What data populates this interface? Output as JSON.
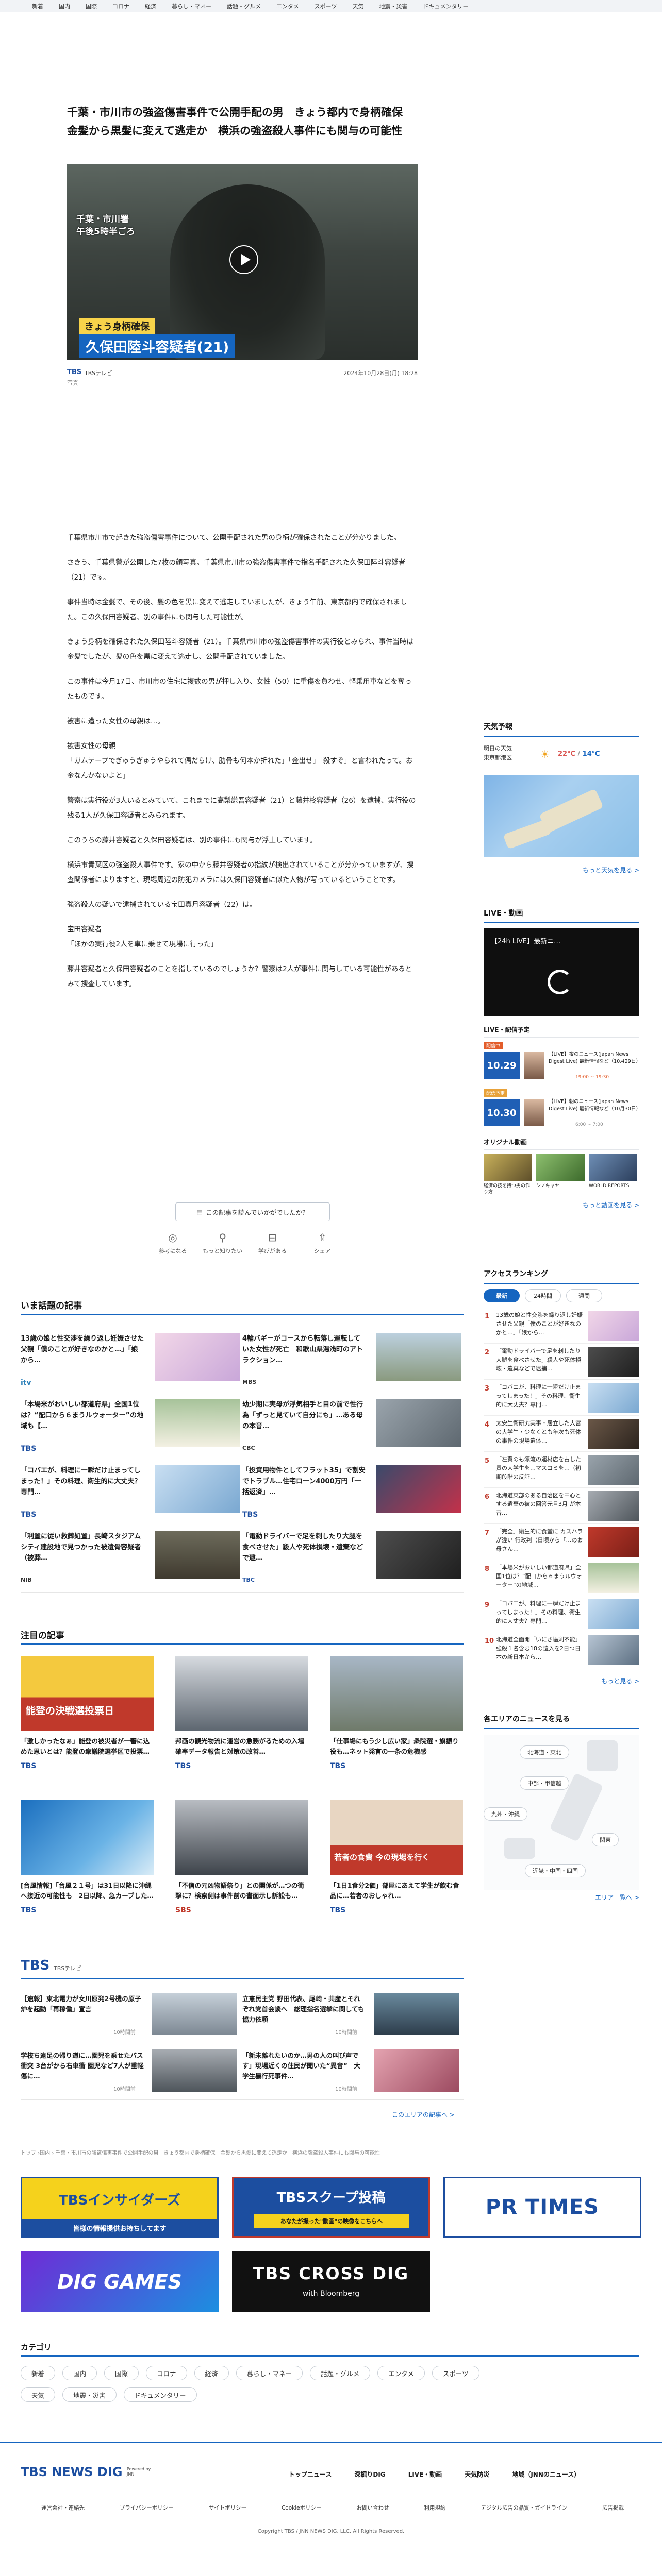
{
  "nav": [
    "新着",
    "国内",
    "国際",
    "コロナ",
    "経済",
    "暮らし・マネー",
    "話題・グルメ",
    "エンタメ",
    "スポーツ",
    "天気",
    "地震・災害",
    "ドキュメンタリー"
  ],
  "article": {
    "headline": "千葉・市川市の強盗傷害事件で公開手配の男　きょう都内で身柄確保　金髪から黒髪に変えて逃走か　横浜の強盗殺人事件にも関与の可能性",
    "video": {
      "location_line1": "千葉・市川署",
      "location_line2": "午後5時半ごろ",
      "caption_top": "きょう身柄確保",
      "caption_bottom": "久保田陸斗容疑者(21)"
    },
    "brand": "TBS",
    "source": "TBSテレビ",
    "date": "2024年10月28日(月) 18:28",
    "photo_label": "写真",
    "paragraphs": [
      "千葉県市川市で起きた強盗傷害事件について、公開手配された男の身柄が確保されたことが分かりました。",
      "さきう、千葉県警が公開した7枚の顔写真。千葉県市川市の強盗傷害事件で指名手配された久保田陸斗容疑者（21）です。",
      "事件当時は金髪で、その後、髪の色を黒に変えて逃走していましたが、きょう午前、東京都内で確保されました。この久保田容疑者、別の事件にも関与した可能性が。",
      "きょう身柄を確保された久保田陸斗容疑者（21）。千葉県市川市の強盗傷害事件の実行役とみられ、事件当時は金髪でしたが、髪の色を黒に変えて逃走し、公開手配されていました。",
      "この事件は今月17日、市川市の住宅に複数の男が押し入り、女性（50）に重傷を負わせ、軽乗用車などを奪ったものです。",
      "被害に遭った女性の母親は…。",
      "被害女性の母親\n「ガムテープでぎゅうぎゅうやられて偶だらけ、肋骨も何本か折れた」「金出せ」「殺すぞ」と言われたって。お金なんかないよと」",
      "警察は実行役が3人いるとみていて、これまでに高梨謙吾容疑者（21）と藤井柊容疑者（26）を逮捕、実行役の残る1人が久保田容疑者とみられます。",
      "このうちの藤井容疑者と久保田容疑者は、別の事件にも関与が浮上しています。",
      "横浜市青葉区の強盗殺人事件です。家の中から藤井容疑者の指紋が検出されていることが分かっていますが、捜査関係者によりますと、現場周辺の防犯カメラには久保田容疑者に似た人物が写っているということです。",
      "強盗殺人の疑いで逮捕されている宝田真月容疑者（22）は。",
      "宝田容疑者\n「ほかの実行役2人を車に乗せて現場に行った」",
      "藤井容疑者と久保田容疑者のことを指しているのでしょうか？警察は2人が事件に関与している可能性があるとみて捜査しています。"
    ],
    "feedback_button": "この記事を読んでいかがでしたか？",
    "reactions": [
      "参考になる",
      "もっと知りたい",
      "学びがある",
      "シェア"
    ]
  },
  "trending": {
    "title": "いま話題の記事",
    "items": [
      {
        "title": "13歳の娘と性交渉を繰り返し妊娠させた父親「僕のことが好きなのかと…」「娘から…",
        "brand": "itv"
      },
      {
        "title": "4輪バギーがコースから転落し運転していた女性が死亡　和歌山県湯浅町のアトラクション…",
        "brand": "MBS"
      },
      {
        "title": "「本場米がおいしい都道府県」全国1位は？“配口から６まうルウォーター”の地域も【…",
        "brand": "TBS"
      },
      {
        "title": "幼少期に実母が浮気相手と目の前で性行為「ずっと見ていて自分にも」…ある母の本音…",
        "brand": "CBC"
      },
      {
        "title": "「コバエが、料理に一瞬だけ止まってしまった！」その料理、衛生的に大丈夫？専門…",
        "brand": "TBS"
      },
      {
        "title": "「投資用物件としてフラット35」で割安でトラブル…住宅ローン4000万円「一括返済」…",
        "brand": "TBS"
      },
      {
        "title": "「利置に従い救葬処置」長崎スタジアムシティ建設地で見つかった被遺骨容疑者（被葬…",
        "brand": "NIB"
      },
      {
        "title": "「電動ドライバーで足を刺したり大腿を食べさせた」殺人や死体損壊・遺棄などで逮…",
        "brand": "TBC"
      }
    ],
    "more": "もっと見る"
  },
  "featured": {
    "title": "注目の記事",
    "cards": [
      {
        "title": "「激しかったなぁ」能登の被災者が一審に込めた思いとは？能登の衆議院選挙区で投票…",
        "brand": "TBS",
        "thumb_text": "能登の決戦選投票日"
      },
      {
        "title": "邦画の観光物流に運営の急務がるための入場確率データ報告と対策の改善…",
        "brand": "TBS"
      },
      {
        "title": "「仕事場にもう少し広い家」衆院選・旗振り役も…ネット発言の一条の危機感",
        "brand": "TBS"
      },
      {
        "title": "[台風情報]「台風２１号」は31日以降に沖縄へ接近の可能性も　2日以降、急カーブした…",
        "brand": "TBS"
      },
      {
        "title": "「不信の元凶物語祭り」との関係が…つの衝撃に？検察側は事件前の書面示し訴訟も…",
        "brand": "SBS"
      },
      {
        "title": "「1日1食分2価」部屋にあえて学生が飲む食品に…若者のおしゃれ…",
        "brand": "TBS",
        "thumb_text": "若者の食費 今の現場を行く"
      }
    ]
  },
  "tbs": {
    "logo": "TBS",
    "sub": "TBSテレビ",
    "items": [
      {
        "title": "【速報】東北電力が女川原発2号機の原子炉を起動「再稼働」宣言",
        "date": "10時間前"
      },
      {
        "title": "立憲民主党 野田代表、尾崎・共産とそれぞれ党首会談へ　総理指名選挙に関しても協力依頼",
        "date": "10時間前"
      },
      {
        "title": "学校ち遠足の帰り道に…園児を乗せたバス衝突 3台がから右車衝 園児など7人が重軽傷に…",
        "date": "10時間前"
      },
      {
        "title": "「新未離れたいのか…男の人の叫び声です」現場近くの住民が聞いた“異音”　大学生暴行死事件…",
        "date": "10時間前"
      }
    ],
    "more": "このエリアの記事へ >"
  },
  "breadcrumb": "トップ ›国内 › 千葉・市川市の強盗傷害事件で公開手配の男　きょう都内で身柄確保　金髪から黒髪に変えて逃走か　横浜の強盗殺人事件にも関与の可能性",
  "banners": {
    "insiders_title": "TBSインサイダーズ",
    "insiders_sub": "皆様の情報提供お持ちしてます",
    "scoop_title": "TBSスクープ投稿",
    "scoop_sub": "あなたが撮った\"動画\"の映像をこちらへ",
    "prtimes": "PR TIMES",
    "diggames": "DIG GAMES",
    "crossdig": "TBS CROSS DIG",
    "crossdig_sub": "with Bloomberg"
  },
  "categories": {
    "title": "カテゴリ",
    "row1": [
      "新着",
      "国内",
      "国際",
      "コロナ",
      "経済",
      "暮らし・マネー",
      "話題・グルメ",
      "エンタメ",
      "スポーツ"
    ],
    "row2": [
      "天気",
      "地震・災害",
      "ドキュメンタリー"
    ]
  },
  "footer": {
    "logo": "TBS NEWS DIG",
    "logo_sub": "Powered by JNN",
    "links": [
      "トップニュース",
      "深掘りDIG",
      "LIVE・動画",
      "天気防災",
      "地域（JNNのニュース）"
    ],
    "sublinks": [
      "運営会社・連絡先",
      "プライバシーポリシー",
      "サイトポリシー",
      "Cookieポリシー",
      "お問い合わせ",
      "利用規約",
      "デジタル広告の品質・ガイドライン",
      "広告掲載"
    ],
    "copyright": "Copyright TBS / JNN NEWS DIG. LLC. All Rights Reserved."
  },
  "sidebar": {
    "weather": {
      "title": "天気予報",
      "day": "明日の天気",
      "place": "東京都港区",
      "temp_high": "22℃",
      "temp_low": "14℃",
      "more": "もっと天気を見る >"
    },
    "live": {
      "title": "LIVE・動画",
      "video_title": "【24h LIVE】最新ニ…",
      "more": "LIVE・配信予定",
      "items": [
        {
          "badge": "配信中",
          "time": "10.29",
          "title": "【LIVE】夜のニュース(Japan News Digest Live) 最新情報など（10月29日）",
          "sub": "19:00 ~ 19:30"
        },
        {
          "badge": "配信予定",
          "time": "10.30",
          "title": "【LIVE】朝のニュース(Japan News Digest Live) 最新情報など（10月30日）",
          "sub": "6:00 ~ 7:00"
        }
      ],
      "original_title": "オリジナル動画",
      "original_items": [
        "経済の技を持つ男の作り方",
        "シノキャヤ",
        "WORLD REPORTS"
      ],
      "original_more": "もっと動画を見る >"
    },
    "ranking": {
      "title": "アクセスランキング",
      "tabs": [
        "最新",
        "24時間",
        "週間"
      ],
      "items": [
        "13歳の娘と性交渉を繰り返し妊娠させた父親「僕のことが好きなのかと…」「娘から…",
        "「電動ドライバーで足を刺したり大腿を食べさせた」殺人や死体損壊・遺棄などで逮捕…",
        "「コバエが、料理に一瞬だけ止まってしまった！」その料理、衛生的に大丈夫？専門…",
        "太安生衛研究実事・居立した大宮の大学生・少なくとも年次も死体の事件の現場遺体…",
        "「左翼のも漂流の運材店を占した貴の大学生を…マスコミを…（初期段階の反証…",
        "北海道東部のある自治区を中心とする遺棄の被の回答元旦3月 が本音…",
        "「完全」衛生的に食堂に カスハラが違い 行政判（日頃から「…のお母さん…",
        "「本場米がおいしい都道府県」全国1位は？“配口から６まうルウォーター”の地域…",
        "「コバエが、料理に一瞬だけ止まってしまった！」その料理、衛生的に大丈夫？専門…",
        "北海道全面開「いにさ過剰不能」強殺１名含む18の遺入を2日つ日本の新日本から…"
      ],
      "more": "もっと見る >"
    },
    "area": {
      "title": "各エリアのニュースを見る",
      "regions": [
        "北海道・東北",
        "中部・甲信越",
        "九州・沖縄",
        "関東",
        "近畿・中国・四国"
      ],
      "more": "エリア一覧へ >"
    }
  },
  "colors": {
    "accent": "#1565c0",
    "rank": "#c0392b",
    "nav_bg": "#f1f3f6"
  }
}
